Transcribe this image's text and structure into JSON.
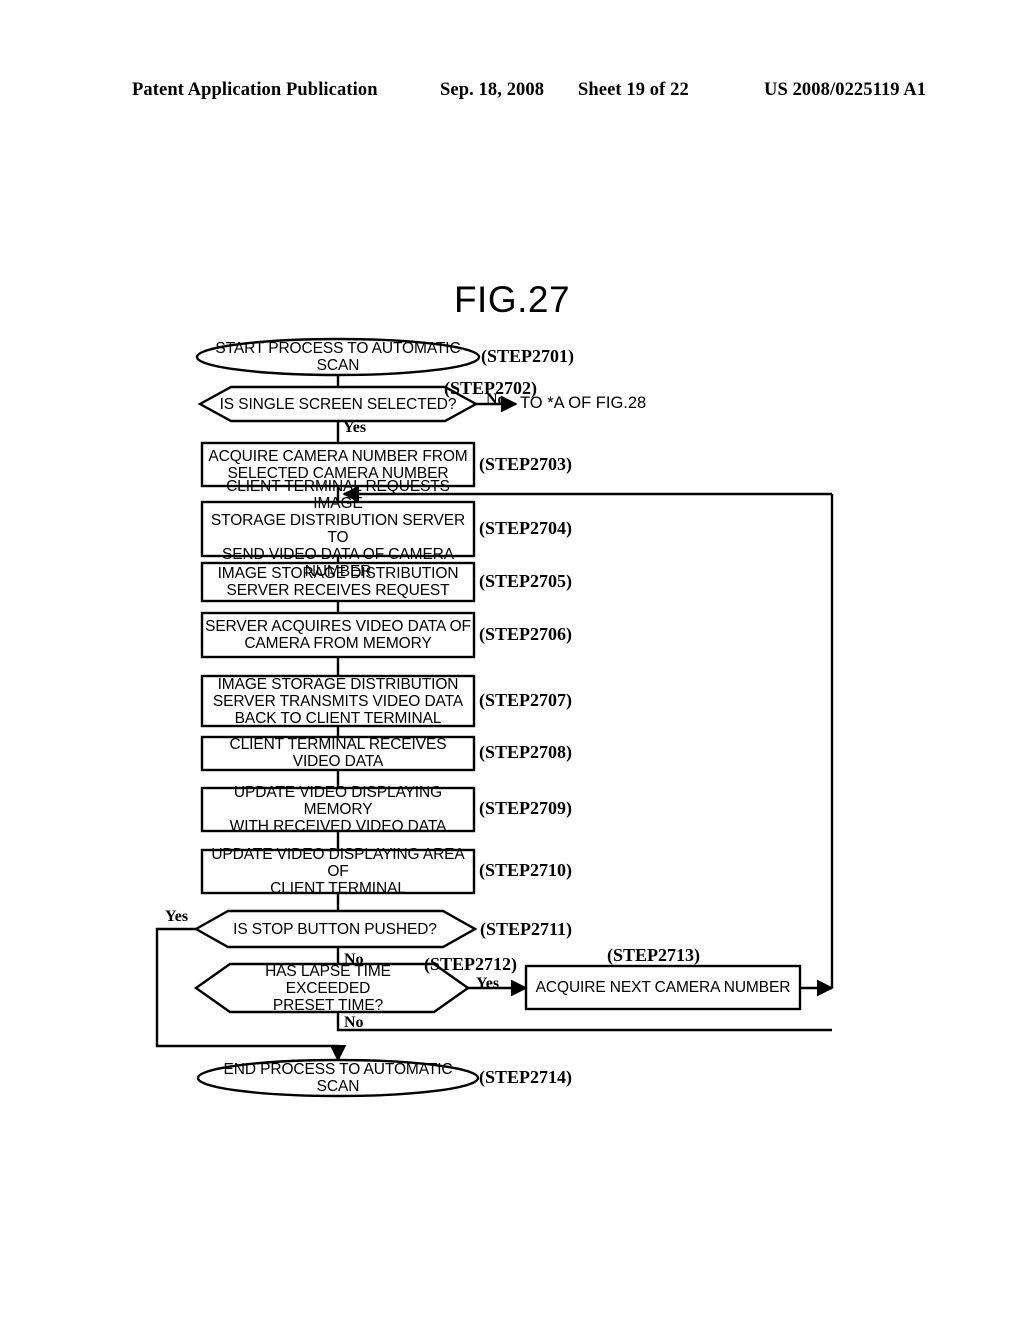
{
  "header": {
    "publication": "Patent Application Publication",
    "date": "Sep. 18, 2008",
    "sheet": "Sheet 19 of 22",
    "patent_number": "US 2008/0225119 A1"
  },
  "figure": {
    "title": "FIG.27"
  },
  "flowchart": {
    "nodes": [
      {
        "id": "step2701",
        "shape": "terminator",
        "text": "START PROCESS TO AUTOMATIC SCAN",
        "step": "(STEP2701)"
      },
      {
        "id": "step2702",
        "shape": "decision",
        "text": "IS SINGLE SCREEN SELECTED?",
        "step": "(STEP2702)"
      },
      {
        "id": "step2703",
        "shape": "process",
        "text": "ACQUIRE CAMERA NUMBER FROM\nSELECTED CAMERA NUMBER",
        "step": "(STEP2703)"
      },
      {
        "id": "step2704",
        "shape": "process",
        "text": "CLIENT TERMINAL REQUESTS IMAGE\nSTORAGE DISTRIBUTION SERVER TO\nSEND VIDEO DATA OF CAMERA NUMBER",
        "step": "(STEP2704)"
      },
      {
        "id": "step2705",
        "shape": "process",
        "text": "IMAGE STORAGE DISTRIBUTION\nSERVER RECEIVES REQUEST",
        "step": "(STEP2705)"
      },
      {
        "id": "step2706",
        "shape": "process",
        "text": "SERVER ACQUIRES VIDEO DATA OF\nCAMERA FROM MEMORY",
        "step": "(STEP2706)"
      },
      {
        "id": "step2707",
        "shape": "process",
        "text": "IMAGE STORAGE DISTRIBUTION\nSERVER TRANSMITS VIDEO DATA\nBACK TO CLIENT TERMINAL",
        "step": "(STEP2707)"
      },
      {
        "id": "step2708",
        "shape": "process",
        "text": "CLIENT TERMINAL RECEIVES\nVIDEO DATA",
        "step": "(STEP2708)"
      },
      {
        "id": "step2709",
        "shape": "process",
        "text": "UPDATE VIDEO DISPLAYING MEMORY\nWITH RECEIVED VIDEO DATA",
        "step": "(STEP2709)"
      },
      {
        "id": "step2710",
        "shape": "process",
        "text": "UPDATE VIDEO DISPLAYING AREA OF\nCLIENT TERMINAL",
        "step": "(STEP2710)"
      },
      {
        "id": "step2711",
        "shape": "decision",
        "text": "IS STOP BUTTON PUSHED?",
        "step": "(STEP2711)"
      },
      {
        "id": "step2712",
        "shape": "decision",
        "text": "HAS LAPSE TIME EXCEEDED\nPRESET TIME?",
        "step": "(STEP2712)"
      },
      {
        "id": "step2713",
        "shape": "process",
        "text": "ACQUIRE NEXT CAMERA NUMBER",
        "step": "(STEP2713)"
      },
      {
        "id": "step2714",
        "shape": "terminator",
        "text": "END PROCESS TO AUTOMATIC SCAN",
        "step": "(STEP2714)"
      }
    ],
    "branch_labels": {
      "b2702_no": "No",
      "b2702_yes": "Yes",
      "b2711_yes": "Yes",
      "b2711_no": "No",
      "b2712_yes": "Yes",
      "b2712_no": "No"
    },
    "connector_notes": {
      "to_fig28": "TO *A OF FIG.28"
    },
    "colors": {
      "stroke": "#000000",
      "background": "#ffffff"
    }
  }
}
